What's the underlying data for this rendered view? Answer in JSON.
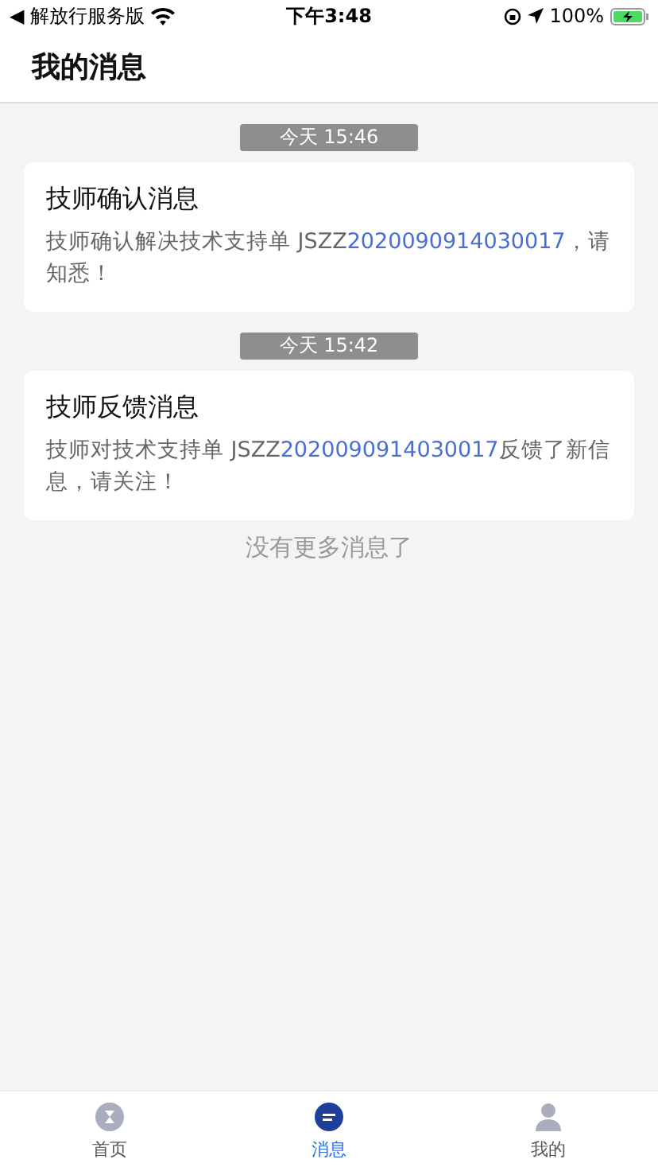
{
  "status_bar": {
    "back_app": "◀ 解放行服务版",
    "time": "下午3:48",
    "battery": "100%"
  },
  "header": {
    "title": "我的消息"
  },
  "messages": [
    {
      "time": "今天 15:46",
      "title": "技师确认消息",
      "body_before": "技师确认解决技术支持单 JSZZ",
      "order_no": "2020090914030017",
      "body_after": "，请知悉！"
    },
    {
      "time": "今天 15:42",
      "title": "技师反馈消息",
      "body_before": "技师对技术支持单 JSZZ",
      "order_no": "2020090914030017",
      "body_after": "反馈了新信息，请关注！"
    }
  ],
  "end_note": "没有更多消息了",
  "tabs": [
    {
      "label": "首页",
      "kind": "home",
      "selected": false
    },
    {
      "label": "消息",
      "kind": "message",
      "selected": true
    },
    {
      "label": "我的",
      "kind": "profile",
      "selected": false
    }
  ]
}
